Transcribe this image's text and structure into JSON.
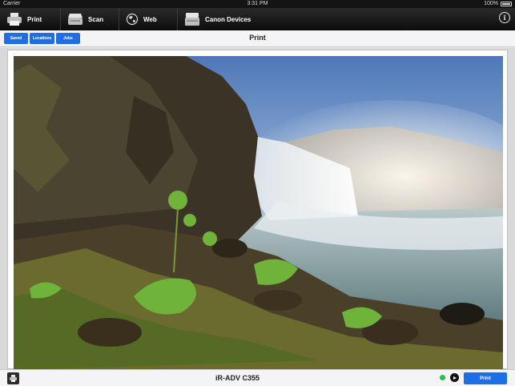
{
  "status_bar": {
    "carrier": "Carrier",
    "time": "3:31 PM",
    "battery": "100%"
  },
  "nav": {
    "items": [
      {
        "label": "Print",
        "icon": "printer-icon"
      },
      {
        "label": "Scan",
        "icon": "scanner-icon"
      },
      {
        "label": "Web",
        "icon": "globe-icon"
      },
      {
        "label": "Canon Devices",
        "icon": "device-icon"
      }
    ],
    "info_icon": "i"
  },
  "toolbar": {
    "title": "Print",
    "buttons": {
      "saved": "Saved",
      "locations": "Locations",
      "jobs": "Jobs"
    }
  },
  "preview": {
    "image": "waterfall-landscape-photo"
  },
  "bottom": {
    "printer_name": "iR-ADV C355",
    "print_label": "Print",
    "status_color": "#27c24a",
    "accent_color": "#1e6fe6"
  }
}
